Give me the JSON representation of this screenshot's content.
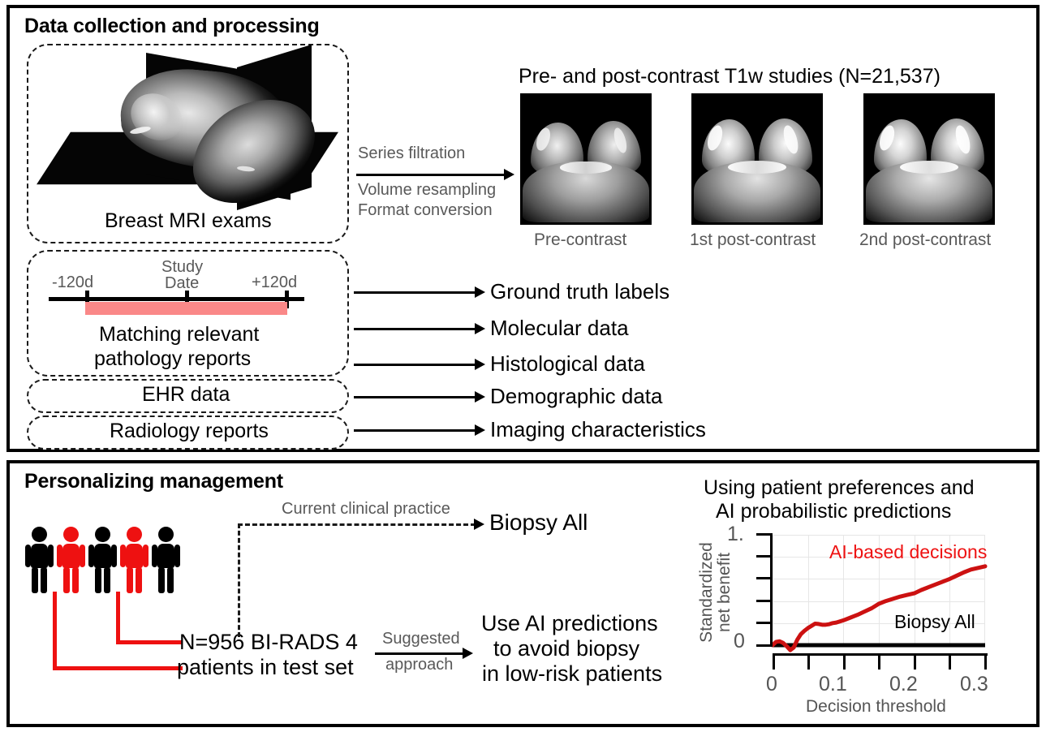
{
  "figure": {
    "panels": [
      {
        "id": "top",
        "title": "Data collection and processing"
      },
      {
        "id": "bottom",
        "title": "Personalizing management"
      }
    ]
  },
  "top_panel": {
    "title": "Data collection and processing",
    "mri_box_label": "Breast MRI exams",
    "processing_steps": {
      "step1": "Series filtration",
      "step2": "Volume resampling",
      "step3": "Format conversion"
    },
    "studies_heading": "Pre- and post-contrast T1w studies (N=21,537)",
    "studies_count": "21,537",
    "mri_series": [
      {
        "label": "Pre-contrast",
        "name": "pre-contrast"
      },
      {
        "label": "1st post-contrast",
        "name": "first-post-contrast"
      },
      {
        "label": "2nd post-contrast",
        "name": "second-post-contrast"
      }
    ],
    "timeline": {
      "left_label": "-120d",
      "center_label_line1": "Study",
      "center_label_line2": "Date",
      "right_label": "+120d",
      "window_days": 240,
      "bar_color": "#fa8888"
    },
    "source_boxes": [
      {
        "label_line1": "Matching relevant",
        "label_line2": "pathology reports",
        "name": "pathology-reports-box"
      },
      {
        "label_line1": "EHR data",
        "label_line2": "",
        "name": "ehr-data-box"
      },
      {
        "label_line1": "Radiology reports",
        "label_line2": "",
        "name": "radiology-reports-box"
      }
    ],
    "outputs": [
      {
        "label": "Ground truth labels",
        "name": "ground-truth-labels"
      },
      {
        "label": "Molecular data",
        "name": "molecular-data"
      },
      {
        "label": "Histological data",
        "name": "histological-data"
      },
      {
        "label": "Demographic data",
        "name": "demographic-data"
      },
      {
        "label": "Imaging characteristics",
        "name": "imaging-characteristics"
      }
    ]
  },
  "bottom_panel": {
    "title": "Personalizing management",
    "cohort": {
      "figures": [
        "black",
        "red",
        "black",
        "red",
        "black"
      ],
      "callout_line1": "N=956 BI-RADS 4",
      "callout_line2": "patients in test set",
      "n": "956",
      "birads": "BI-RADS 4"
    },
    "current_practice": {
      "arrow_label": "Current clinical practice",
      "outcome": "Biopsy All"
    },
    "suggested": {
      "arrow_label_line1": "Suggested",
      "arrow_label_line2": "approach",
      "outcome_line1": "Use AI predictions",
      "outcome_line2": "to avoid biopsy",
      "outcome_line3": "in low-risk patients"
    }
  },
  "chart_data": {
    "type": "line",
    "title_line1": "Using patient preferences and",
    "title_line2": "AI probabilistic predictions",
    "xlabel": "Decision threshold",
    "ylabel_line1": "Standardized",
    "ylabel_line2": "net benefit",
    "xlim": [
      0,
      0.3
    ],
    "ylim": [
      0,
      1.0
    ],
    "xticks": [
      0,
      0.05,
      0.1,
      0.15,
      0.2,
      0.25,
      0.3
    ],
    "xtick_labels": [
      "0",
      "",
      "0.1",
      "",
      "0.2",
      "",
      "0.3"
    ],
    "yticks": [
      0,
      0.2,
      0.4,
      0.6,
      0.8,
      1.0
    ],
    "ytick_labels": [
      "0",
      "",
      "",
      "",
      "",
      "1."
    ],
    "grid": true,
    "legend_position": "inline-annotation",
    "series": [
      {
        "name": "AI-based decisions",
        "color": "#cc1111",
        "annotation": "AI-based decisions",
        "x": [
          0.0,
          0.005,
          0.01,
          0.015,
          0.02,
          0.025,
          0.03,
          0.035,
          0.04,
          0.045,
          0.05,
          0.055,
          0.06,
          0.065,
          0.07,
          0.075,
          0.08,
          0.085,
          0.09,
          0.095,
          0.1,
          0.11,
          0.12,
          0.13,
          0.14,
          0.15,
          0.16,
          0.17,
          0.18,
          0.19,
          0.2,
          0.21,
          0.22,
          0.23,
          0.24,
          0.25,
          0.26,
          0.27,
          0.28,
          0.29,
          0.3
        ],
        "y": [
          0.0,
          0.03,
          0.035,
          0.02,
          -0.01,
          -0.045,
          -0.02,
          0.05,
          0.1,
          0.13,
          0.155,
          0.175,
          0.195,
          0.192,
          0.185,
          0.185,
          0.19,
          0.2,
          0.205,
          0.215,
          0.225,
          0.25,
          0.275,
          0.305,
          0.335,
          0.375,
          0.4,
          0.42,
          0.44,
          0.455,
          0.47,
          0.5,
          0.525,
          0.55,
          0.575,
          0.6,
          0.63,
          0.66,
          0.685,
          0.7,
          0.715
        ]
      },
      {
        "name": "Biopsy All",
        "color": "#000000",
        "annotation": "Biopsy All",
        "x": [
          0.0,
          0.3
        ],
        "y": [
          0.0,
          0.0
        ]
      }
    ]
  }
}
